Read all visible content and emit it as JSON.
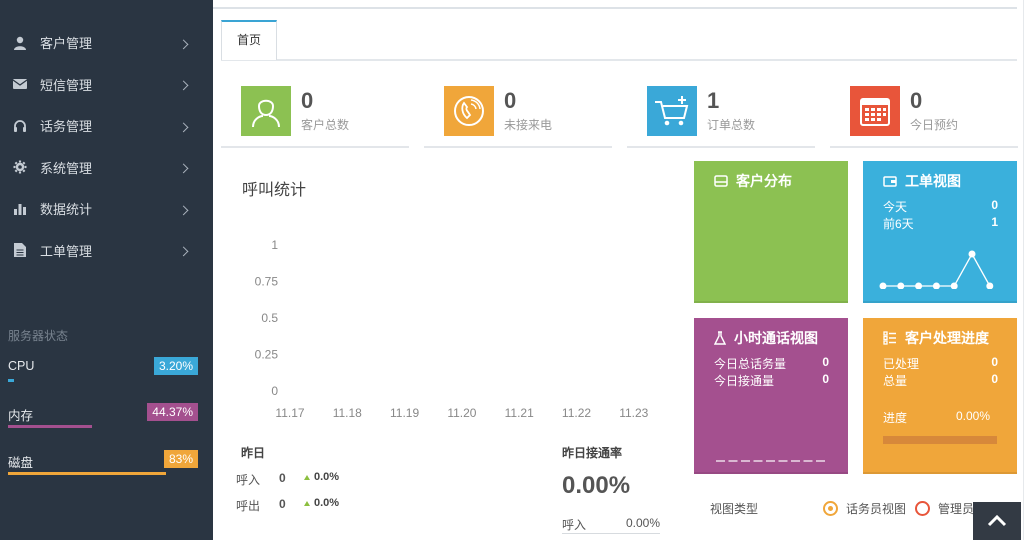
{
  "sidebar": {
    "items": [
      {
        "label": "客户管理",
        "icon": "user-icon"
      },
      {
        "label": "短信管理",
        "icon": "envelope-icon"
      },
      {
        "label": "话务管理",
        "icon": "headset-icon"
      },
      {
        "label": "系统管理",
        "icon": "gear-icon"
      },
      {
        "label": "数据统计",
        "icon": "bar-chart-icon"
      },
      {
        "label": "工单管理",
        "icon": "document-icon"
      }
    ],
    "server_title": "服务器状态",
    "stats": [
      {
        "label": "CPU",
        "value": "3.20%",
        "percent": 3.2,
        "color": "#3aa8d8"
      },
      {
        "label": "内存",
        "value": "44.37%",
        "percent": 44.37,
        "color": "#a4508f"
      },
      {
        "label": "磁盘",
        "value": "83%",
        "percent": 83,
        "color": "#f0a63a"
      }
    ]
  },
  "tab": {
    "label": "首页"
  },
  "cards": [
    {
      "value": "0",
      "label": "客户总数",
      "color": "#8cc152",
      "icon": "person-icon"
    },
    {
      "value": "0",
      "label": "未接来电",
      "color": "#f0a63a",
      "icon": "phone-icon"
    },
    {
      "value": "1",
      "label": "订单总数",
      "color": "#3aa8d8",
      "icon": "cart-icon"
    },
    {
      "value": "0",
      "label": "今日预约",
      "color": "#e8553a",
      "icon": "calendar-icon"
    }
  ],
  "chart": {
    "title": "呼叫统计"
  },
  "chart_data": {
    "type": "line",
    "title": "呼叫统计",
    "x": [
      "11.17",
      "11.18",
      "11.19",
      "11.20",
      "11.21",
      "11.22",
      "11.23"
    ],
    "y_ticks": [
      "1",
      "0.75",
      "0.5",
      "0.25",
      "0"
    ],
    "ylim": [
      0,
      1
    ],
    "grid": false
  },
  "yesterday": {
    "title": "昨日",
    "rows": [
      {
        "label": "呼入",
        "value": "0",
        "pct": "0.0%"
      },
      {
        "label": "呼出",
        "value": "0",
        "pct": "0.0%"
      }
    ]
  },
  "rate": {
    "title": "昨日接通率",
    "value": "0.00%",
    "row_label": "呼入",
    "row_value": "0.00%"
  },
  "tiles": {
    "customer_dist": {
      "title": "客户分布",
      "color": "#8cc152",
      "icon": "drive-icon"
    },
    "workorder": {
      "title": "工单视图",
      "color": "#3ab0dc",
      "icon": "wallet-icon",
      "rows": [
        {
          "label": "今天",
          "value": "0"
        },
        {
          "label": "前6天",
          "value": "1"
        }
      ],
      "spark": [
        0,
        0,
        0,
        0,
        0,
        1,
        0
      ]
    },
    "hourly": {
      "title": "小时通话视图",
      "color": "#a4508f",
      "icon": "flask-icon",
      "rows": [
        {
          "label": "今日总话务量",
          "value": "0"
        },
        {
          "label": "今日接通量",
          "value": "0"
        }
      ]
    },
    "progress": {
      "title": "客户处理进度",
      "color": "#f0a63a",
      "icon": "list-icon",
      "rows": [
        {
          "label": "已处理",
          "value": "0"
        },
        {
          "label": "总量",
          "value": "0"
        }
      ],
      "progress_label": "进度",
      "progress_value": "0.00%",
      "percent": 0
    }
  },
  "view": {
    "label": "视图类型",
    "options": [
      {
        "label": "话务员视图",
        "selected": true
      },
      {
        "label": "管理员",
        "selected": false
      }
    ]
  }
}
